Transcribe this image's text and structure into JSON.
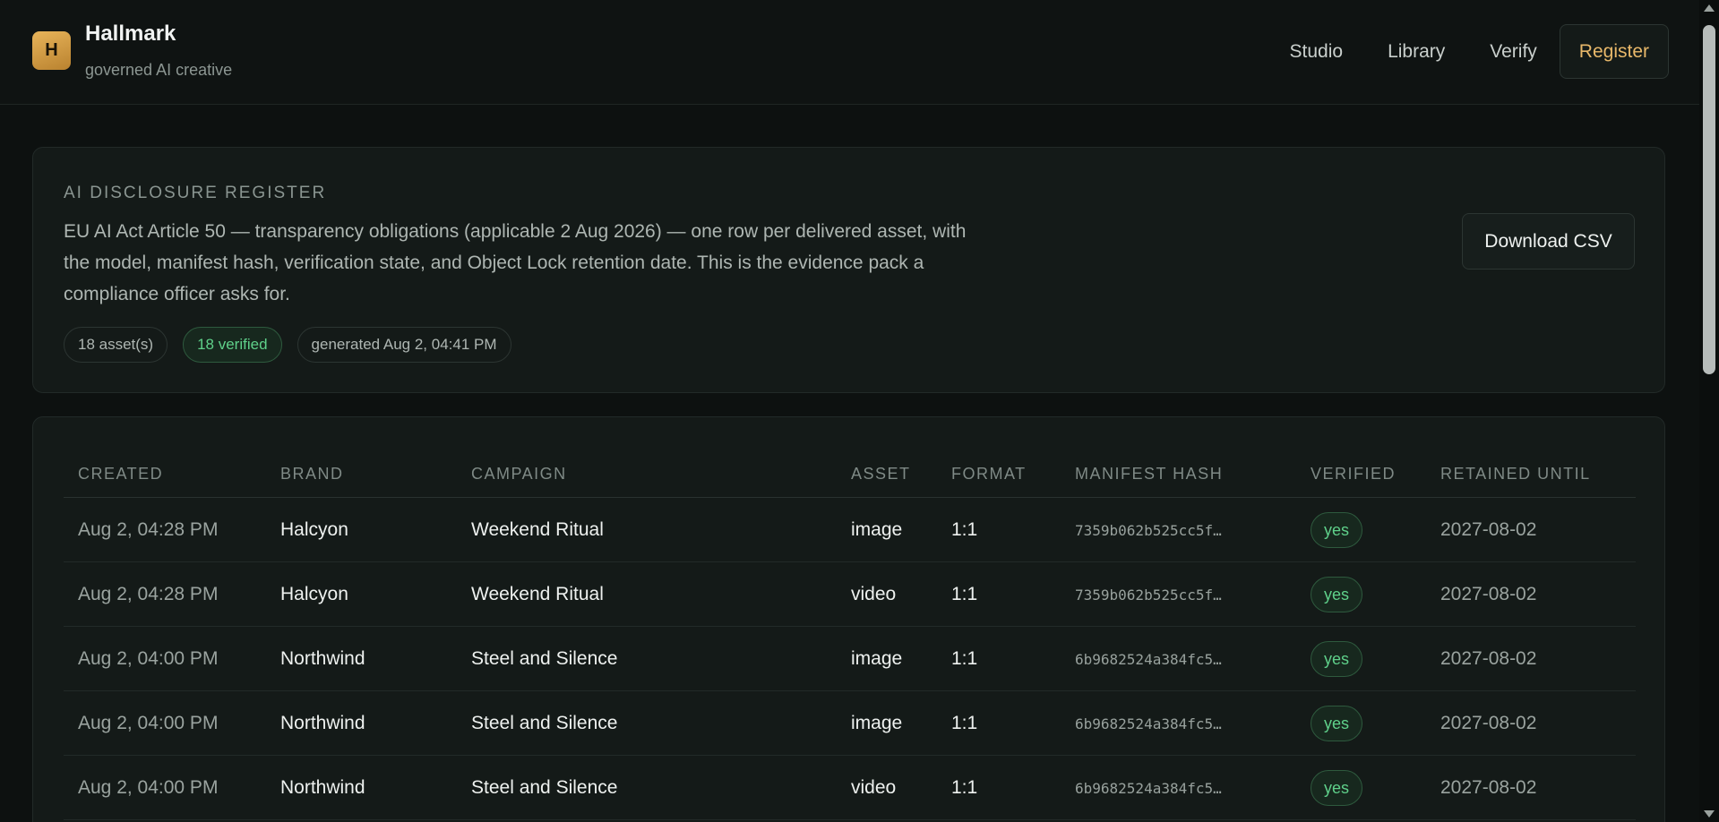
{
  "app": {
    "logo_letter": "H",
    "name": "Hallmark",
    "tagline": "governed AI creative"
  },
  "nav": {
    "items": [
      {
        "label": "Studio"
      },
      {
        "label": "Library"
      },
      {
        "label": "Verify"
      },
      {
        "label": "Register"
      }
    ],
    "active": "Register"
  },
  "register": {
    "title": "AI DISCLOSURE REGISTER",
    "description": "EU AI Act Article 50 — transparency obligations (applicable 2 Aug 2026) — one row per delivered asset, with the model, manifest hash, verification state, and Object Lock retention date. This is the evidence pack a compliance officer asks for.",
    "download_label": "Download CSV",
    "pills": {
      "assets": "18 asset(s)",
      "verified": "18 verified",
      "generated": "generated Aug 2, 04:41 PM"
    }
  },
  "table": {
    "columns": {
      "created": "CREATED",
      "brand": "BRAND",
      "campaign": "CAMPAIGN",
      "asset": "ASSET",
      "format": "FORMAT",
      "hash": "MANIFEST HASH",
      "verified": "VERIFIED",
      "retained": "RETAINED UNTIL"
    },
    "rows": [
      {
        "created": "Aug 2, 04:28 PM",
        "brand": "Halcyon",
        "campaign": "Weekend Ritual",
        "asset": "image",
        "format": "1:1",
        "hash": "7359b062b525cc5f…",
        "verified": "yes",
        "retained": "2027-08-02"
      },
      {
        "created": "Aug 2, 04:28 PM",
        "brand": "Halcyon",
        "campaign": "Weekend Ritual",
        "asset": "video",
        "format": "1:1",
        "hash": "7359b062b525cc5f…",
        "verified": "yes",
        "retained": "2027-08-02"
      },
      {
        "created": "Aug 2, 04:00 PM",
        "brand": "Northwind",
        "campaign": "Steel and Silence",
        "asset": "image",
        "format": "1:1",
        "hash": "6b9682524a384fc5…",
        "verified": "yes",
        "retained": "2027-08-02"
      },
      {
        "created": "Aug 2, 04:00 PM",
        "brand": "Northwind",
        "campaign": "Steel and Silence",
        "asset": "image",
        "format": "1:1",
        "hash": "6b9682524a384fc5…",
        "verified": "yes",
        "retained": "2027-08-02"
      },
      {
        "created": "Aug 2, 04:00 PM",
        "brand": "Northwind",
        "campaign": "Steel and Silence",
        "asset": "video",
        "format": "1:1",
        "hash": "6b9682524a384fc5…",
        "verified": "yes",
        "retained": "2027-08-02"
      }
    ]
  },
  "colors": {
    "background": "#0d1110",
    "card": "#141a18",
    "accent": "#e8b86a",
    "success": "#5fd08a"
  }
}
